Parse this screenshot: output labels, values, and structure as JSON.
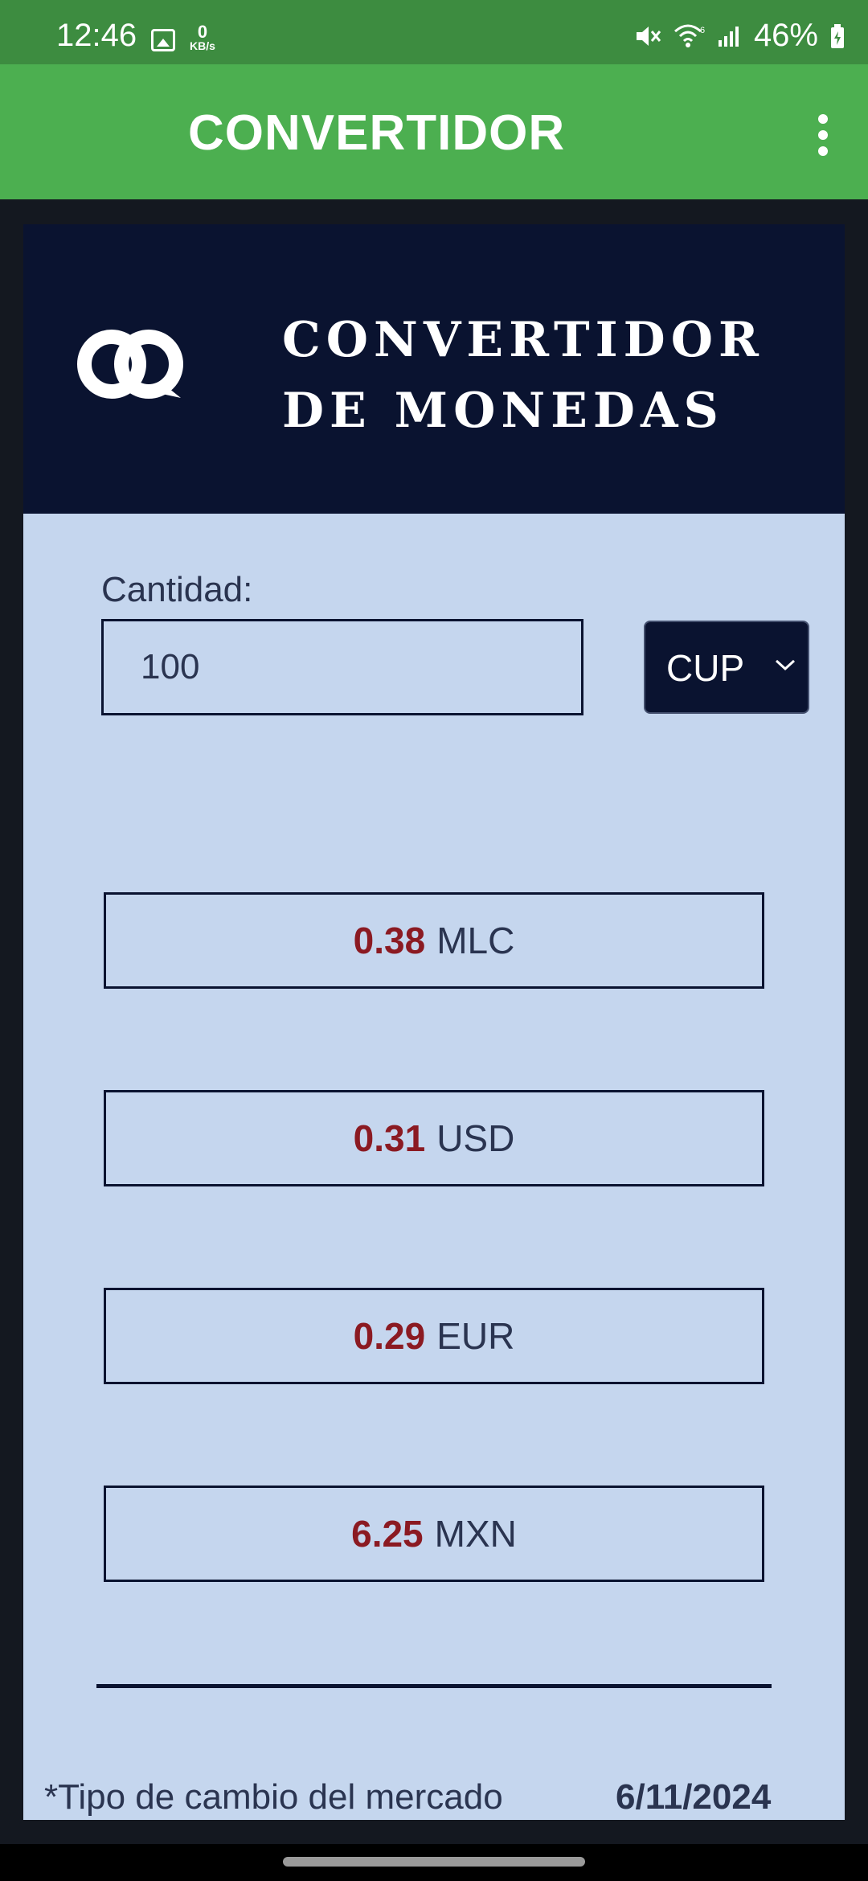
{
  "status_bar": {
    "time": "12:46",
    "net_speed_value": "0",
    "net_speed_unit": "KB/s",
    "battery": "46%",
    "icons": [
      "gallery-icon",
      "mute-icon",
      "wifi-icon",
      "signal-icon",
      "battery-icon"
    ]
  },
  "app_bar": {
    "title": "CONVERTIDOR",
    "menu_icon": "more-vert-icon"
  },
  "card": {
    "header_line1": "CONVERTIDOR",
    "header_line2": "DE MONEDAS",
    "logo_icon": "linked-chat-icon"
  },
  "form": {
    "quantity_label": "Cantidad:",
    "quantity_value": "100",
    "currency_selected": "CUP"
  },
  "results": [
    {
      "amount": "0.38",
      "currency": "MLC"
    },
    {
      "amount": "0.31",
      "currency": "USD"
    },
    {
      "amount": "0.29",
      "currency": "EUR"
    },
    {
      "amount": "6.25",
      "currency": "MXN"
    }
  ],
  "footer": {
    "note": "*Tipo de cambio del mercado",
    "date": "6/11/2024"
  },
  "colors": {
    "status_bar": "#3d8c40",
    "app_bar": "#4caf50",
    "card_header": "#0a1330",
    "card_body": "#c5d6ee",
    "amount": "#8b1a22"
  }
}
